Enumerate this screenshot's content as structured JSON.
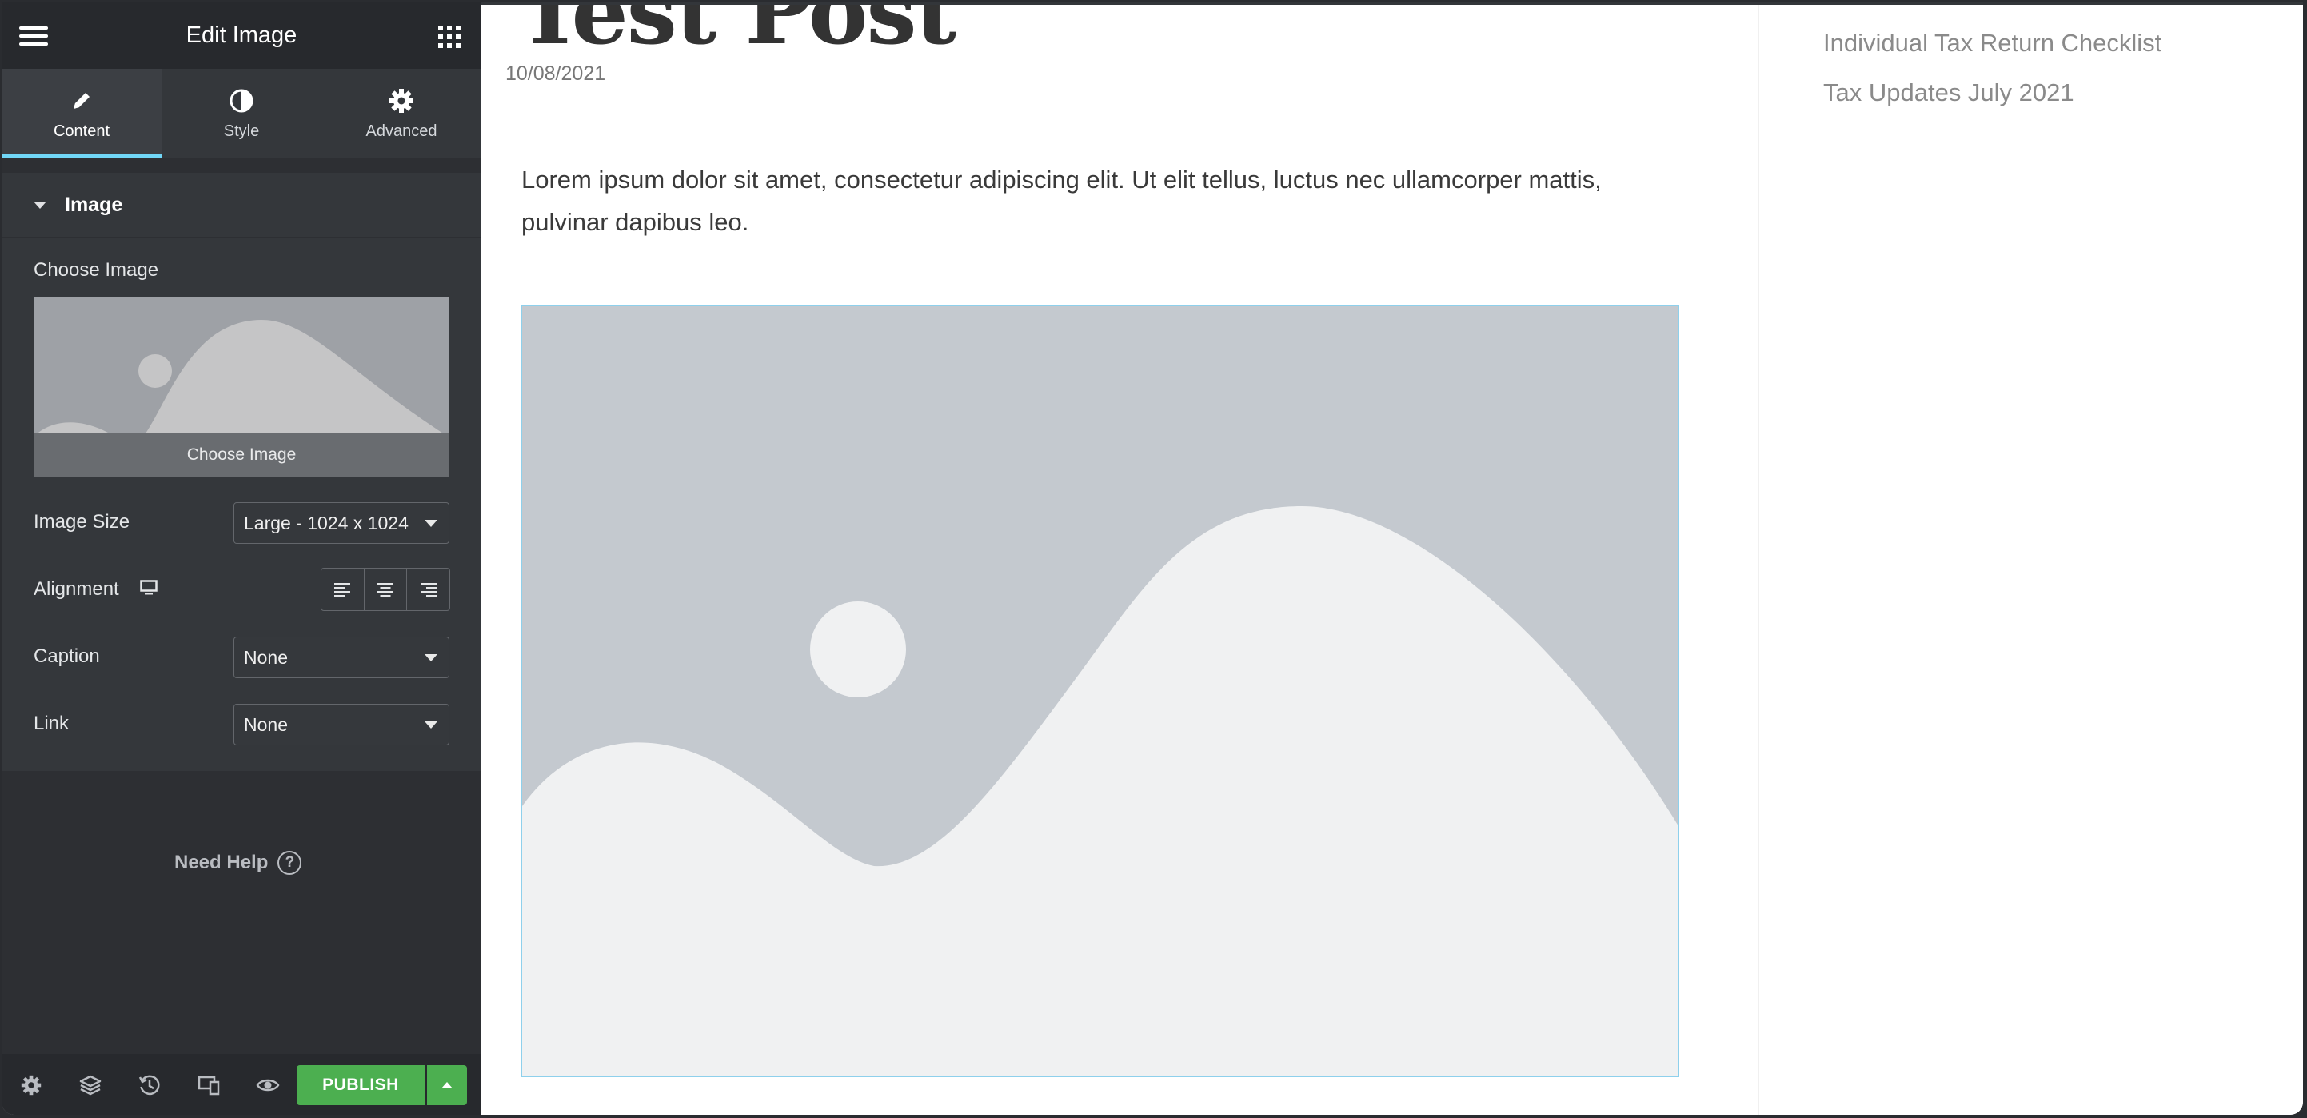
{
  "panel": {
    "title": "Edit Image",
    "tabs": [
      {
        "label": "Content",
        "icon": "pencil-icon",
        "active": true
      },
      {
        "label": "Style",
        "icon": "half-circle-icon",
        "active": false
      },
      {
        "label": "Advanced",
        "icon": "gear-icon",
        "active": false
      }
    ],
    "section_title": "Image",
    "choose_image": {
      "label": "Choose Image",
      "button_label": "Choose Image"
    },
    "image_size": {
      "label": "Image Size",
      "value": "Large - 1024 x 1024"
    },
    "alignment": {
      "label": "Alignment",
      "device_icon": "desktop-icon",
      "options": [
        "align-left-icon",
        "align-center-icon",
        "align-right-icon"
      ]
    },
    "caption": {
      "label": "Caption",
      "value": "None"
    },
    "link": {
      "label": "Link",
      "value": "None"
    },
    "help_label": "Need Help",
    "help_icon_glyph": "?",
    "footer": {
      "icons": [
        "settings-icon",
        "navigator-layers-icon",
        "history-icon",
        "responsive-mode-icon",
        "preview-eye-icon"
      ],
      "publish_label": "PUBLISH"
    }
  },
  "post": {
    "title": "Test Post",
    "date": "10/08/2021",
    "body": "Lorem ipsum dolor sit amet, consectetur adipiscing elit. Ut elit tellus, luctus nec ullamcorper mattis, pulvinar dapibus leo."
  },
  "sidebar": {
    "recent_posts": [
      "Individual Tax Return Checklist",
      "Tax Updates July 2021"
    ]
  },
  "colors": {
    "panel_bg": "#34373b",
    "header_bg": "#27292d",
    "accent": "#71d7f7",
    "publish": "#4caf50",
    "placeholder_bg": "#c4c9cf",
    "placeholder_fg": "#f0f1f2"
  }
}
